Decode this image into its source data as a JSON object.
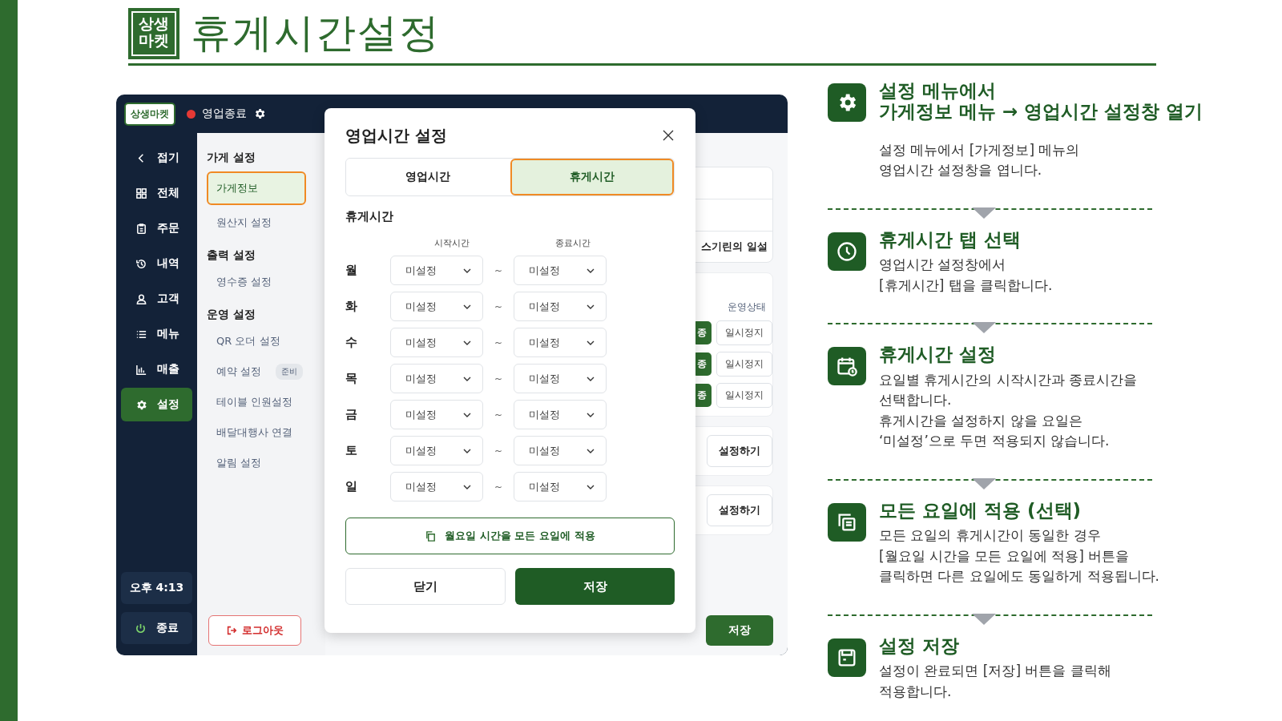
{
  "page_title": {
    "logo": "상생마켓",
    "title": "휴게시간설정"
  },
  "app": {
    "logo": "상생마켓",
    "status": {
      "label": "영업종료",
      "color": "#e53935"
    },
    "nav": [
      {
        "label": "접기",
        "selected": false
      },
      {
        "label": "전체",
        "selected": false
      },
      {
        "label": "주문",
        "selected": false
      },
      {
        "label": "내역",
        "selected": false
      },
      {
        "label": "고객",
        "selected": false
      },
      {
        "label": "메뉴",
        "selected": false
      },
      {
        "label": "매출",
        "selected": false
      },
      {
        "label": "설정",
        "selected": true
      }
    ],
    "clock": "오후 4:13",
    "exit": "종료",
    "submenu": [
      {
        "title": "가게 설정",
        "items": [
          {
            "label": "가게정보",
            "selected": true
          },
          {
            "label": "원산지 설정",
            "selected": false
          }
        ]
      },
      {
        "title": "출력 설정",
        "items": [
          {
            "label": "영수증 설정",
            "selected": false
          }
        ]
      },
      {
        "title": "운영 설정",
        "items": [
          {
            "label": "QR 오더 설정",
            "selected": false
          },
          {
            "label": "예약 설정",
            "selected": false,
            "badge": "준비"
          },
          {
            "label": "테이블 인원설정",
            "selected": false
          },
          {
            "label": "배달대행사 연결",
            "selected": false
          },
          {
            "label": "알림 설정",
            "selected": false
          }
        ]
      }
    ],
    "logout": "로그아웃",
    "background": {
      "cut_text": "스기린의 일설",
      "status_header": "운영상태",
      "rows": [
        {
          "badge": "종",
          "action": "일시정지"
        },
        {
          "badge": "종",
          "action": "일시정지"
        },
        {
          "badge": "종",
          "action": "일시정지"
        }
      ],
      "setup_buttons": [
        "설정하기",
        "설정하기"
      ],
      "save": "저장"
    },
    "dialog": {
      "title": "영업시간 설정",
      "tabs": [
        {
          "label": "영업시간",
          "selected": false
        },
        {
          "label": "휴게시간",
          "selected": true
        }
      ],
      "section": "휴게시간",
      "columns": [
        "시작시간",
        "종료시간"
      ],
      "days": [
        {
          "day": "월",
          "start": "미설정",
          "separator": "~",
          "end": "미설정"
        },
        {
          "day": "화",
          "start": "미설정",
          "separator": "~",
          "end": "미설정"
        },
        {
          "day": "수",
          "start": "미설정",
          "separator": "~",
          "end": "미설정"
        },
        {
          "day": "목",
          "start": "미설정",
          "separator": "~",
          "end": "미설정"
        },
        {
          "day": "금",
          "start": "미설정",
          "separator": "~",
          "end": "미설정"
        },
        {
          "day": "토",
          "start": "미설정",
          "separator": "~",
          "end": "미설정"
        },
        {
          "day": "일",
          "start": "미설정",
          "separator": "~",
          "end": "미설정"
        }
      ],
      "apply_button": "월요일 시간을 모든 요일에 적용",
      "close_button": "닫기",
      "save_button": "저장"
    }
  },
  "steps": [
    {
      "title": [
        "설정 메뉴에서",
        "가게정보 메뉴 → 영업시간 설정창 열기"
      ],
      "body": [
        "설정 메뉴에서 [가게정보] 메뉴의",
        "영업시간 설정창을 엽니다."
      ]
    },
    {
      "title": [
        "휴게시간 탭 선택"
      ],
      "body": [
        "영업시간 설정창에서",
        "[휴게시간] 탭을 클릭합니다."
      ]
    },
    {
      "title": [
        "휴게시간 설정"
      ],
      "body": [
        "요일별 휴게시간의 시작시간과 종료시간을",
        "선택합니다.",
        "휴게시간을 설정하지 않을 요일은",
        "‘미설정’으로 두면 적용되지 않습니다."
      ]
    },
    {
      "title": [
        "모든 요일에 적용 (선택)"
      ],
      "body": [
        "모든 요일의 휴게시간이 동일한 경우",
        "[월요일 시간을 모든 요일에 적용] 버튼을",
        "클릭하면 다른 요일에도 동일하게 적용됩니다."
      ]
    },
    {
      "title": [
        "설정 저장"
      ],
      "body": [
        "설정이 완료되면 [저장] 버튼을 클릭해",
        "적용합니다."
      ]
    }
  ]
}
